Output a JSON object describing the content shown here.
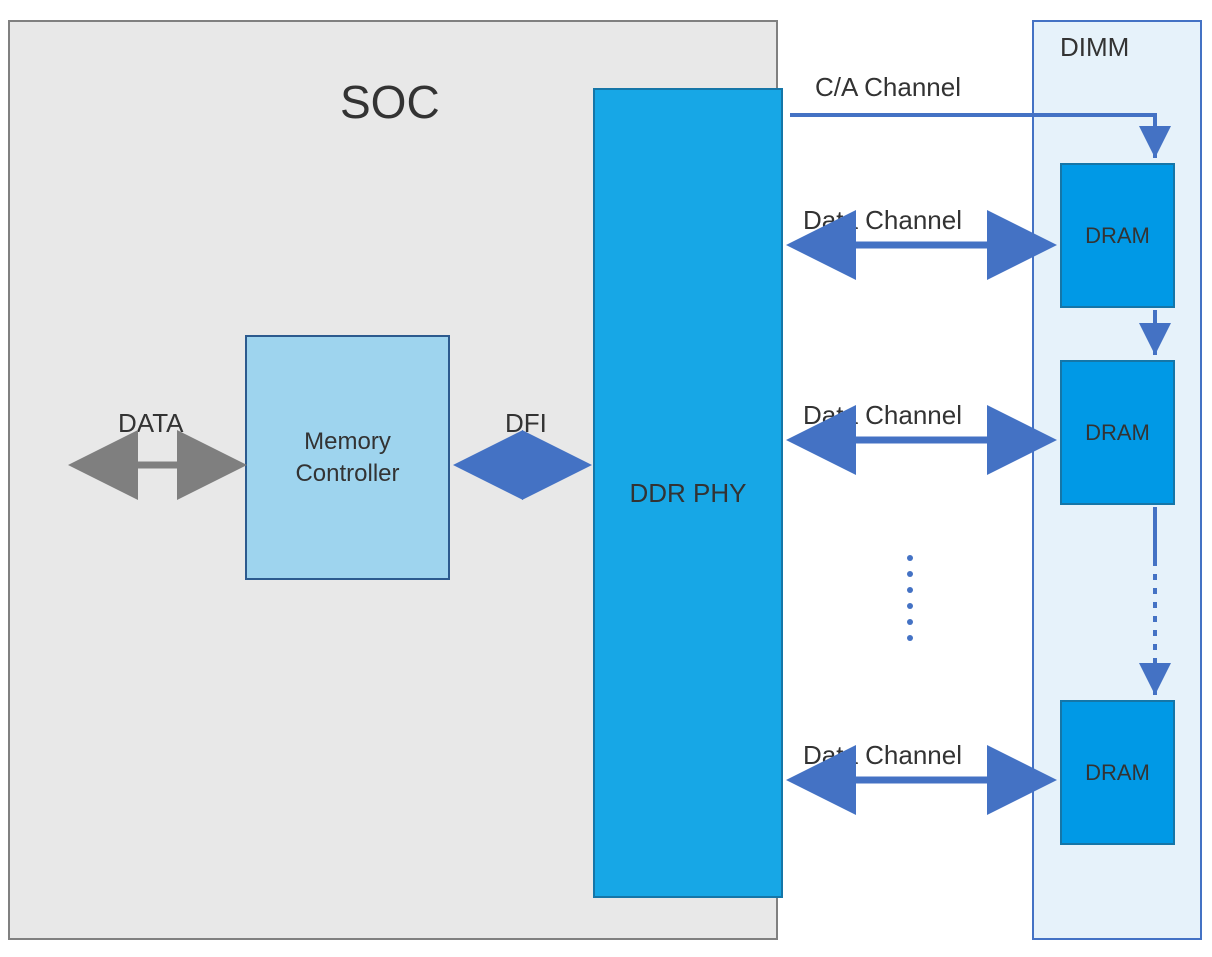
{
  "diagram": {
    "soc": {
      "label": "SOC",
      "memory_controller": "Memory\nController",
      "ddr_phy": "DDR PHY"
    },
    "dimm": {
      "label": "DIMM",
      "dram_label": "DRAM"
    },
    "connections": {
      "data": "DATA",
      "dfi": "DFI",
      "ca_channel": "C/A Channel",
      "data_channel": "Data Channel"
    }
  }
}
